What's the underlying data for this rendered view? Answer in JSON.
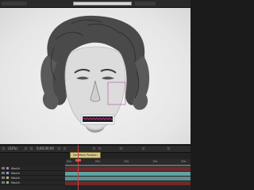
{
  "viewer": {
    "zoom": "(42%)",
    "timecode": "0;00;00;00",
    "tooltip": "Set Mask Position"
  },
  "timeline": {
    "ruler_ticks": [
      "00s",
      "05s",
      "10s",
      "15s",
      "20s"
    ],
    "layers": [
      {
        "name": "Mouth",
        "swatch": "#b07cc6",
        "track": "#6e2b2b"
      },
      {
        "name": "Mouth",
        "swatch": "#7ca8c6",
        "track": "#5fa3a3"
      },
      {
        "name": "Mouth",
        "swatch": "#c6a87c",
        "track": "#5a8f8f"
      },
      {
        "name": "Mouth",
        "swatch": "#7cc67c",
        "track": "#6e2b2b"
      }
    ]
  },
  "colors": {
    "mask_outline": "#c46ea8",
    "mouth_wave": "#b03090",
    "playhead": "#d04040"
  }
}
